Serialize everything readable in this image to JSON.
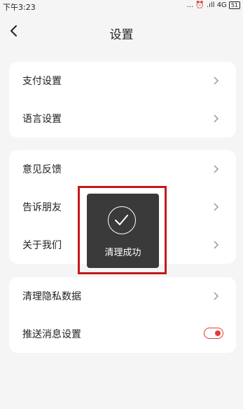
{
  "status_bar": {
    "time": "下午3:23",
    "right_text": "... ⏰ .ıll 4G",
    "battery": "51"
  },
  "header": {
    "title": "设置"
  },
  "card1": {
    "items": [
      {
        "label": "支付设置"
      },
      {
        "label": "语言设置"
      }
    ]
  },
  "card2": {
    "items": [
      {
        "label": "意见反馈"
      },
      {
        "label": "告诉朋友"
      },
      {
        "label": "关于我们"
      }
    ]
  },
  "card3": {
    "items": [
      {
        "label": "清理隐私数据"
      },
      {
        "label": "推送消息设置"
      }
    ],
    "push_toggle_on": true
  },
  "toast": {
    "message": "清理成功"
  },
  "colors": {
    "accent": "#e53935",
    "highlight_border": "#c41a1a",
    "toast_bg": "#3a3a3a",
    "page_bg": "#f5f5f5"
  },
  "icons": [
    "back-arrow-icon",
    "chevron-right-icon",
    "checkmark-icon",
    "alarm-icon",
    "signal-icon",
    "battery-icon"
  ]
}
